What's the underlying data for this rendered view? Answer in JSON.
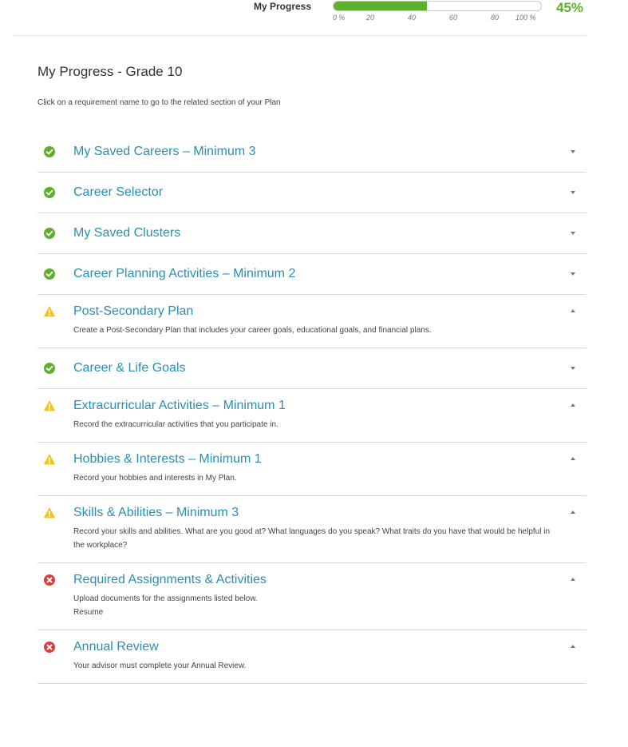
{
  "progress": {
    "label": "My Progress",
    "percent_text": "45%",
    "value": 45,
    "ticks": [
      "0 %",
      "20",
      "40",
      "60",
      "80",
      "100 %"
    ],
    "fill_color": "#5cb02b"
  },
  "page": {
    "title": "My Progress - Grade 10",
    "instructions": "Click on a requirement name to go to the related section of your Plan"
  },
  "colors": {
    "link": "#2a8fb3",
    "complete": "#5cb02b",
    "warning": "#f0c419",
    "error": "#dd3b3b"
  },
  "requirements": [
    {
      "name": "My Saved Careers – Minimum 3",
      "status": "complete",
      "icon": "check-circle-icon",
      "expanded": false,
      "desc": []
    },
    {
      "name": "Career Selector",
      "status": "complete",
      "icon": "check-circle-icon",
      "expanded": false,
      "desc": []
    },
    {
      "name": "My Saved Clusters",
      "status": "complete",
      "icon": "check-circle-icon",
      "expanded": false,
      "desc": []
    },
    {
      "name": "Career Planning Activities – Minimum 2",
      "status": "complete",
      "icon": "check-circle-icon",
      "expanded": false,
      "desc": []
    },
    {
      "name": "Post-Secondary Plan",
      "status": "warning",
      "icon": "warning-triangle-icon",
      "expanded": true,
      "desc": [
        "Create a Post-Secondary Plan that includes your career goals, educational goals, and financial plans."
      ]
    },
    {
      "name": "Career & Life Goals",
      "status": "complete",
      "icon": "check-circle-icon",
      "expanded": false,
      "desc": []
    },
    {
      "name": "Extracurricular Activities – Minimum 1",
      "status": "warning",
      "icon": "warning-triangle-icon",
      "expanded": true,
      "desc": [
        "Record the extracurricular activities that you participate in."
      ]
    },
    {
      "name": "Hobbies & Interests – Minimum 1",
      "status": "warning",
      "icon": "warning-triangle-icon",
      "expanded": true,
      "desc": [
        "Record your hobbies and interests in My Plan."
      ]
    },
    {
      "name": "Skills & Abilities – Minimum 3",
      "status": "warning",
      "icon": "warning-triangle-icon",
      "expanded": true,
      "desc": [
        "Record your skills and abilities. What are you good at? What languages do you speak? What traits do you have that would be helpful in the workplace?"
      ]
    },
    {
      "name": "Required Assignments & Activities",
      "status": "error",
      "icon": "error-circle-icon",
      "expanded": true,
      "desc": [
        "Upload documents for the assignments listed below.",
        "Resume"
      ]
    },
    {
      "name": "Annual Review",
      "status": "error",
      "icon": "error-circle-icon",
      "expanded": true,
      "desc": [
        "Your advisor must complete your Annual Review."
      ]
    }
  ]
}
